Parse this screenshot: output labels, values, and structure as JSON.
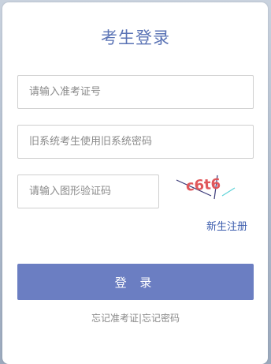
{
  "title": "考生登录",
  "fields": {
    "exam_id_placeholder": "请输入准考证号",
    "old_system_placeholder": "旧系统考生使用旧系统密码",
    "captcha_placeholder": "请输入图形验证码"
  },
  "captcha": {
    "text": "c6t6"
  },
  "links": {
    "register": "新生注册"
  },
  "login_button": "登 录",
  "forgot": {
    "exam_id": "忘记准考证",
    "separator": "|",
    "password": "忘记密码"
  },
  "colors": {
    "accent": "#6b7ec2",
    "title": "#5a73b5",
    "link": "#3b5cad",
    "captcha_text": "#e0575b"
  }
}
